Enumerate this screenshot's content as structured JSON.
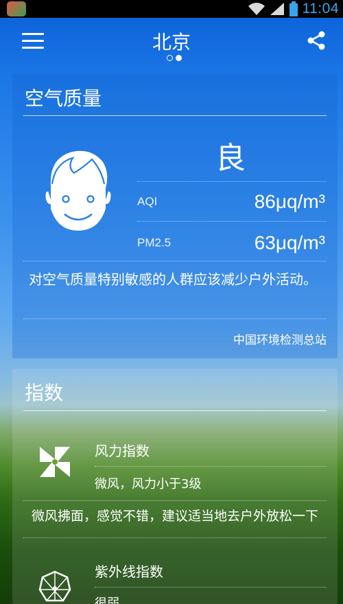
{
  "status_bar": {
    "time": "11:04",
    "icons": [
      "app-notification-icon",
      "wifi-icon",
      "signal-icon",
      "battery-icon"
    ]
  },
  "header": {
    "city": "北京",
    "page_count": 2,
    "active_page": 2
  },
  "air_quality": {
    "title": "空气质量",
    "grade": "良",
    "aqi_label": "AQI",
    "aqi_value": "86μq/m³",
    "pm25_label": "PM2.5",
    "pm25_value": "63μq/m³",
    "advice": "对空气质量特别敏感的人群应该减少户外活动。",
    "source": "中国环境检测总站"
  },
  "index": {
    "title": "指数",
    "items": [
      {
        "icon": "pinwheel-icon",
        "title": "风力指数",
        "summary": "微风，风力小于3级",
        "description": "微风拂面，感觉不错，建议适当地去户外放松一下"
      },
      {
        "icon": "umbrella-icon",
        "title": "紫外线指数",
        "summary": "很弱"
      }
    ]
  },
  "colors": {
    "accent_time": "#36a6e8",
    "status_bar_bg": "#000000"
  }
}
